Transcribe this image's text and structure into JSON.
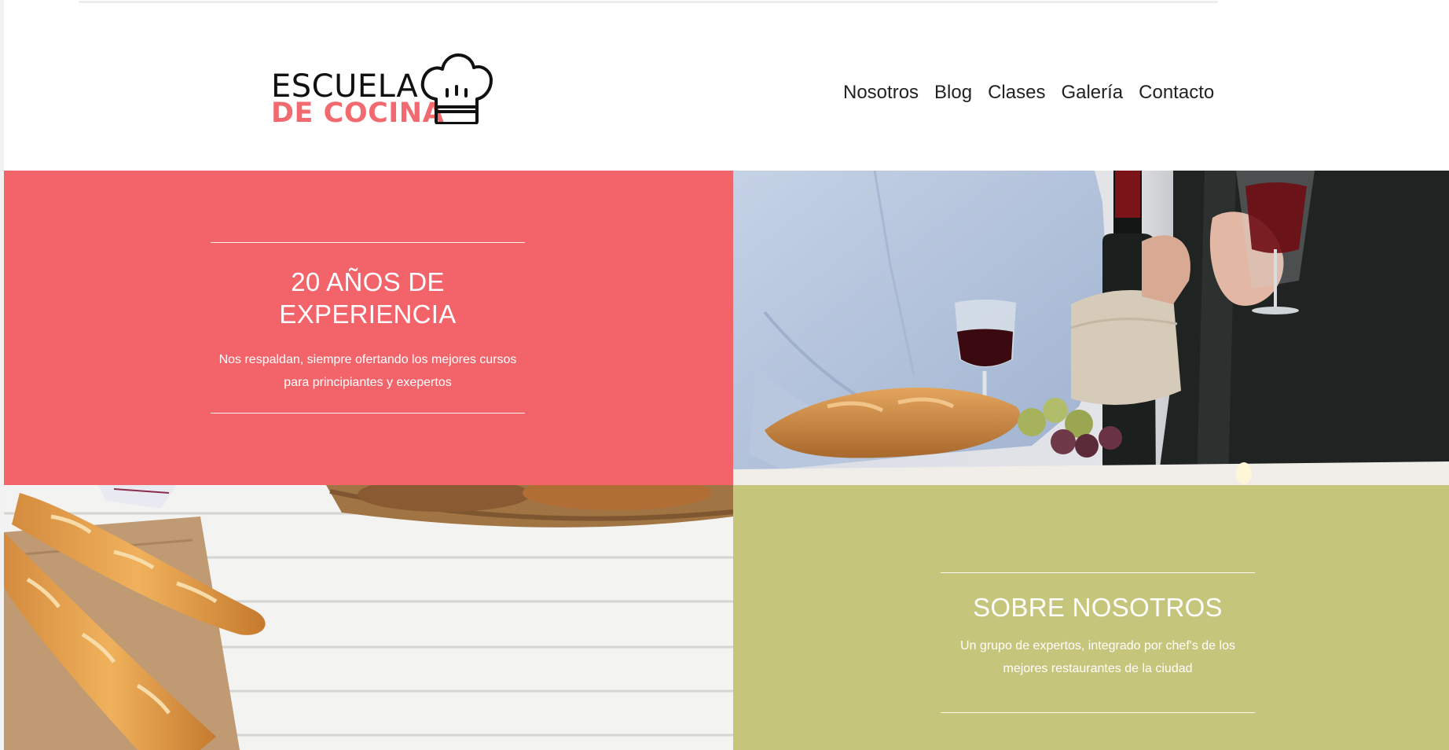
{
  "brand": {
    "line1": "ESCUELA",
    "line2": "DE COCINA",
    "accent_color": "#f16a6f"
  },
  "nav": {
    "items": [
      {
        "label": "Nosotros"
      },
      {
        "label": "Blog"
      },
      {
        "label": "Clases"
      },
      {
        "label": "Galería"
      },
      {
        "label": "Contacto"
      }
    ]
  },
  "experience": {
    "title_line1": "20 AÑOS DE",
    "title_line2": "EXPERIENCIA",
    "text_line1": "Nos respaldan, siempre ofertando los mejores cursos",
    "text_line2": "para principiantes y exepertos",
    "background": "#f3646a"
  },
  "about": {
    "title": "SOBRE NOSOTROS",
    "text_line1": "Un grupo de expertos, integrado por chef's de los",
    "text_line2": "mejores restaurantes de la ciudad",
    "background": "#c6c57c"
  },
  "images": {
    "wine": "wine-dinner-photo",
    "bread": "bread-table-photo"
  }
}
